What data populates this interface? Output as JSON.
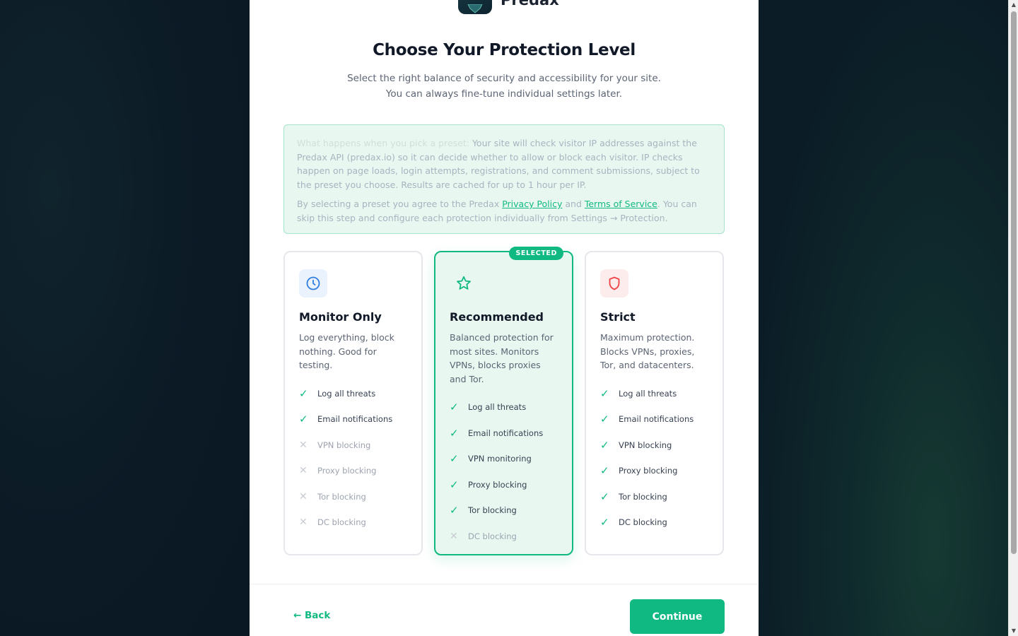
{
  "brand": {
    "name": "Predax"
  },
  "header": {
    "title": "Choose Your Protection Level",
    "subtitle": "Select the right balance of security and accessibility for your site. You can always fine-tune individual settings later."
  },
  "notice": {
    "lead": "What happens when you pick a preset:",
    "body": " Your site will check visitor IP addresses against the Predax API (predax.io) so it can decide whether to allow or block each visitor. IP checks happen on page loads, login attempts, registrations, and comment submissions, subject to the preset you choose. Results are cached for up to 1 hour per IP.",
    "consent_prefix": "By selecting a preset you agree to the Predax ",
    "privacy_link": "Privacy Policy",
    "and": " and ",
    "terms_link": "Terms of Service",
    "consent_suffix": ". You can skip this step and configure each protection individually from Settings → Protection."
  },
  "presets": [
    {
      "title": "Monitor Only",
      "description": "Log everything, block nothing. Good for testing.",
      "icon": "clock-icon",
      "selected": false,
      "features": [
        {
          "label": "Log all threats",
          "enabled": true
        },
        {
          "label": "Email notifications",
          "enabled": true
        },
        {
          "label": "VPN blocking",
          "enabled": false
        },
        {
          "label": "Proxy blocking",
          "enabled": false
        },
        {
          "label": "Tor blocking",
          "enabled": false
        },
        {
          "label": "DC blocking",
          "enabled": false
        }
      ]
    },
    {
      "title": "Recommended",
      "description": "Balanced protection for most sites. Monitors VPNs, blocks proxies and Tor.",
      "icon": "star-icon",
      "selected": true,
      "badge": "SELECTED",
      "features": [
        {
          "label": "Log all threats",
          "enabled": true
        },
        {
          "label": "Email notifications",
          "enabled": true
        },
        {
          "label": "VPN monitoring",
          "enabled": true
        },
        {
          "label": "Proxy blocking",
          "enabled": true
        },
        {
          "label": "Tor blocking",
          "enabled": true
        },
        {
          "label": "DC blocking",
          "enabled": false
        }
      ]
    },
    {
      "title": "Strict",
      "description": "Maximum protection. Blocks VPNs, proxies, Tor, and datacenters.",
      "icon": "shield-icon",
      "selected": false,
      "features": [
        {
          "label": "Log all threats",
          "enabled": true
        },
        {
          "label": "Email notifications",
          "enabled": true
        },
        {
          "label": "VPN blocking",
          "enabled": true
        },
        {
          "label": "Proxy blocking",
          "enabled": true
        },
        {
          "label": "Tor blocking",
          "enabled": true
        },
        {
          "label": "DC blocking",
          "enabled": true
        }
      ]
    }
  ],
  "marks": {
    "yes": "✓",
    "no": "✕"
  },
  "footer": {
    "back_label": "← Back",
    "continue_label": "Continue"
  },
  "colors": {
    "accent": "#10b981",
    "selected_bg": "#e8f8f1",
    "danger": "#ef4444",
    "info": "#2f7de1",
    "page_bg": "#0b1b26"
  }
}
